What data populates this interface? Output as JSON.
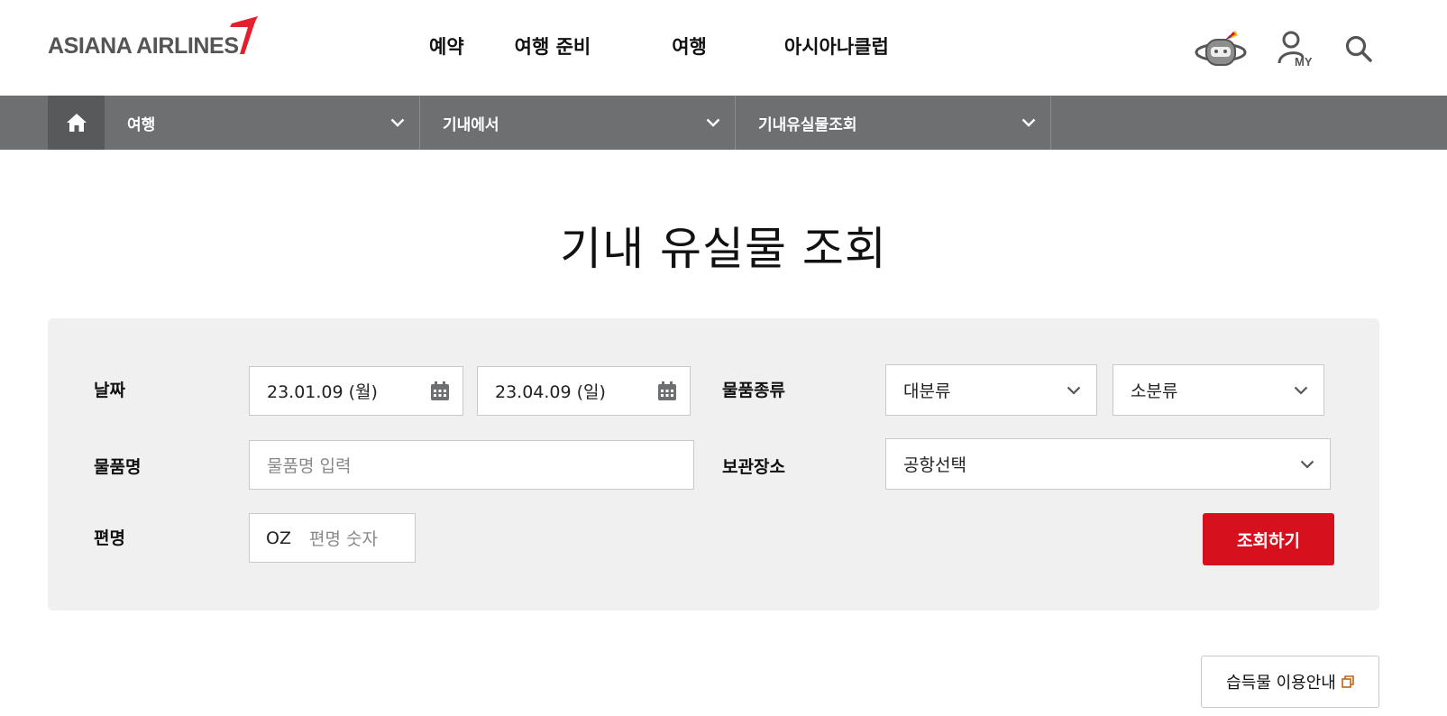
{
  "header": {
    "logo_text": "ASIANA AIRLINES",
    "nav": [
      "예약",
      "여행 준비",
      "여행",
      "아시아나클럽"
    ],
    "my_label": "MY"
  },
  "breadcrumb": {
    "items": [
      "여행",
      "기내에서",
      "기내유실물조회"
    ]
  },
  "page": {
    "title": "기내 유실물 조회"
  },
  "form": {
    "date_label": "날짜",
    "date_from": "23.01.09 (월)",
    "date_to": "23.04.09 (일)",
    "item_type_label": "물품종류",
    "category_major": "대분류",
    "category_minor": "소분류",
    "item_name_label": "물품명",
    "item_name_placeholder": "물품명 입력",
    "storage_label": "보관장소",
    "storage_select": "공항선택",
    "flight_label": "편명",
    "flight_prefix": "OZ",
    "flight_placeholder": "편명 숫자",
    "search_button": "조회하기"
  },
  "guide_button": "습득물 이용안내",
  "colors": {
    "brand_red": "#d7101d",
    "lnb_gray": "#6e6f71",
    "panel_bg": "#f0f0f0"
  },
  "icons": [
    "logo-wing-icon",
    "chatbot-icon",
    "my-user-icon",
    "search-icon",
    "home-icon",
    "chevron-down-icon",
    "calendar-icon",
    "new-window-icon"
  ]
}
